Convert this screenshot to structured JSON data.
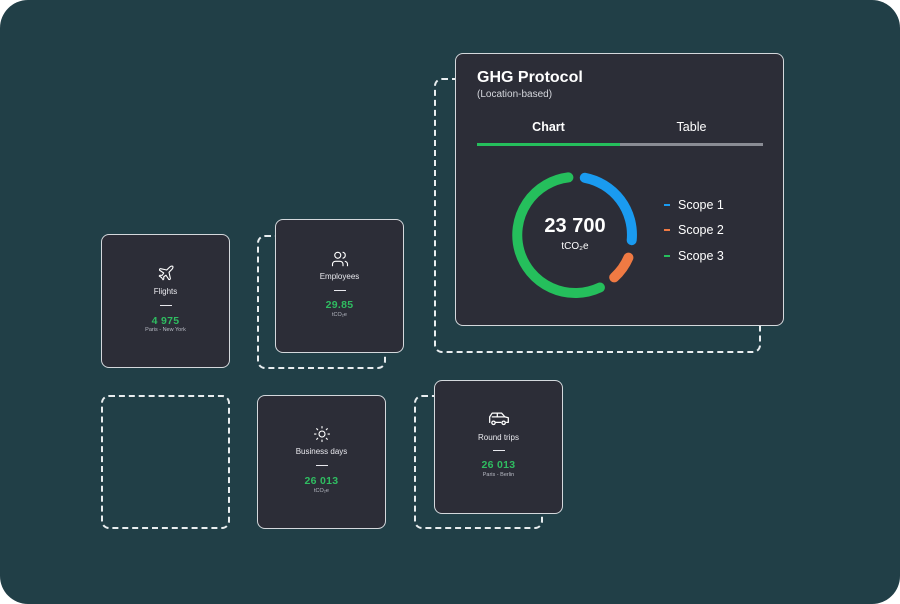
{
  "ghg": {
    "title": "GHG Protocol",
    "subtitle": "(Location-based)",
    "tabs": [
      {
        "label": "Chart",
        "active": true
      },
      {
        "label": "Table",
        "active": false
      }
    ],
    "total_value": "23 700",
    "total_unit": "tCO₂e",
    "legend": [
      {
        "label": "Scope 1",
        "color": "#1a9bf0"
      },
      {
        "label": "Scope 2",
        "color": "#f07a43"
      },
      {
        "label": "Scope 3",
        "color": "#25bf5c"
      }
    ]
  },
  "cards": {
    "flights": {
      "label": "Flights",
      "value": "4 975",
      "sub": "Paris - New York",
      "icon": "airplane-icon"
    },
    "employees": {
      "label": "Employees",
      "value": "29.85",
      "sub": "tCO₂e",
      "icon": "people-icon"
    },
    "business_days": {
      "label": "Business days",
      "value": "26 013",
      "sub": "tCO₂e",
      "icon": "sun-icon"
    },
    "round_trips": {
      "label": "Round trips",
      "value": "26 013",
      "sub": "Paris - Berlin",
      "icon": "car-icon"
    }
  },
  "colors": {
    "background": "#213f47",
    "card": "#2c2d37",
    "accent_green": "#2fbd61"
  }
}
